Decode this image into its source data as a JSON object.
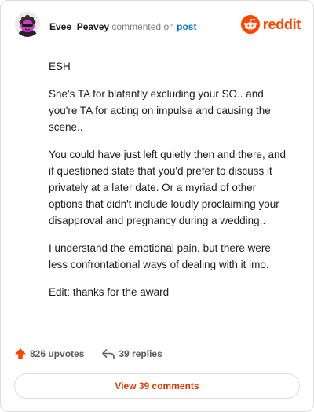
{
  "header": {
    "username": "Evee_Peavey",
    "action_text": " commented on ",
    "post_link": "post",
    "brand": "reddit"
  },
  "comment": {
    "paragraphs": [
      "ESH",
      "She's TA for blatantly excluding your SO.. and you're TA for acting on impulse and causing the scene..",
      "You could have just left quietly then and there, and if questioned state that you'd prefer to discuss it privately at a later date. Or a myriad of other options that didn't include loudly proclaiming your disapproval and pregnancy during a wedding..",
      "I understand the emotional pain, but there were less confrontational ways of dealing with it imo.",
      "Edit: thanks for the award"
    ]
  },
  "actions": {
    "upvotes": "826 upvotes",
    "replies": "39 replies"
  },
  "footer": {
    "view_comments": "View 39 comments"
  },
  "colors": {
    "brand": "#ff4500",
    "link": "#0079d3",
    "view_button_text": "#d93a00"
  },
  "icons": {
    "avatar": "snoo-avatar",
    "logo": "reddit-logo-icon",
    "upvote": "upvote-arrow-icon",
    "reply": "reply-arrow-icon"
  }
}
